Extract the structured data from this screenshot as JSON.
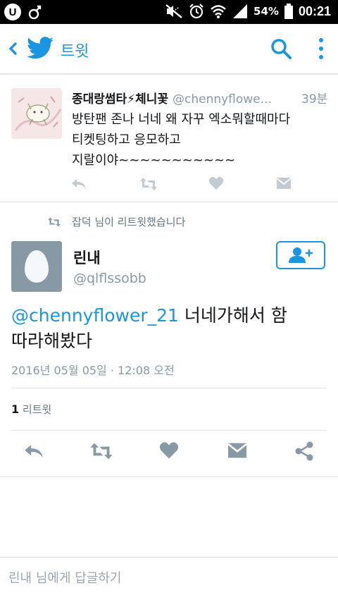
{
  "statusbar": {
    "battery": "54%",
    "time": "00:21",
    "icons": [
      "u-plus-icon",
      "bluetooth-icon",
      "mute-icon",
      "alarm-icon",
      "wifi-icon",
      "signal-icon",
      "battery-icon"
    ]
  },
  "appbar": {
    "title": "트윗",
    "icons": [
      "back-icon",
      "twitter-bird-icon",
      "search-icon",
      "more-vert-icon"
    ],
    "accent": "#1b95e0"
  },
  "quoted_tweet": {
    "name": "종대랑썸타⚡체니꽃",
    "handle": "@chennyflowe...",
    "time": "39분",
    "lines": [
      "방탄팬 존나 너네 왜 자꾸 엑소뭐할때마다",
      "티켓팅하고 응모하고",
      "지랄이야~~~~~~~~~~~"
    ]
  },
  "retweet_notice": "잡덕 님이 리트윗했습니다",
  "main_tweet": {
    "name": "린내",
    "handle": "@qlflssobb",
    "mention": "@chennyflower_21",
    "text_line1": " 너네가해서 함",
    "text_line2": "따라해봤다",
    "date": "2016년 05월 05일 · 12:08 오전",
    "retweet_count": "1",
    "retweet_label": " 리트윗"
  },
  "reply": {
    "placeholder": "린내 님에게 답글하기"
  }
}
